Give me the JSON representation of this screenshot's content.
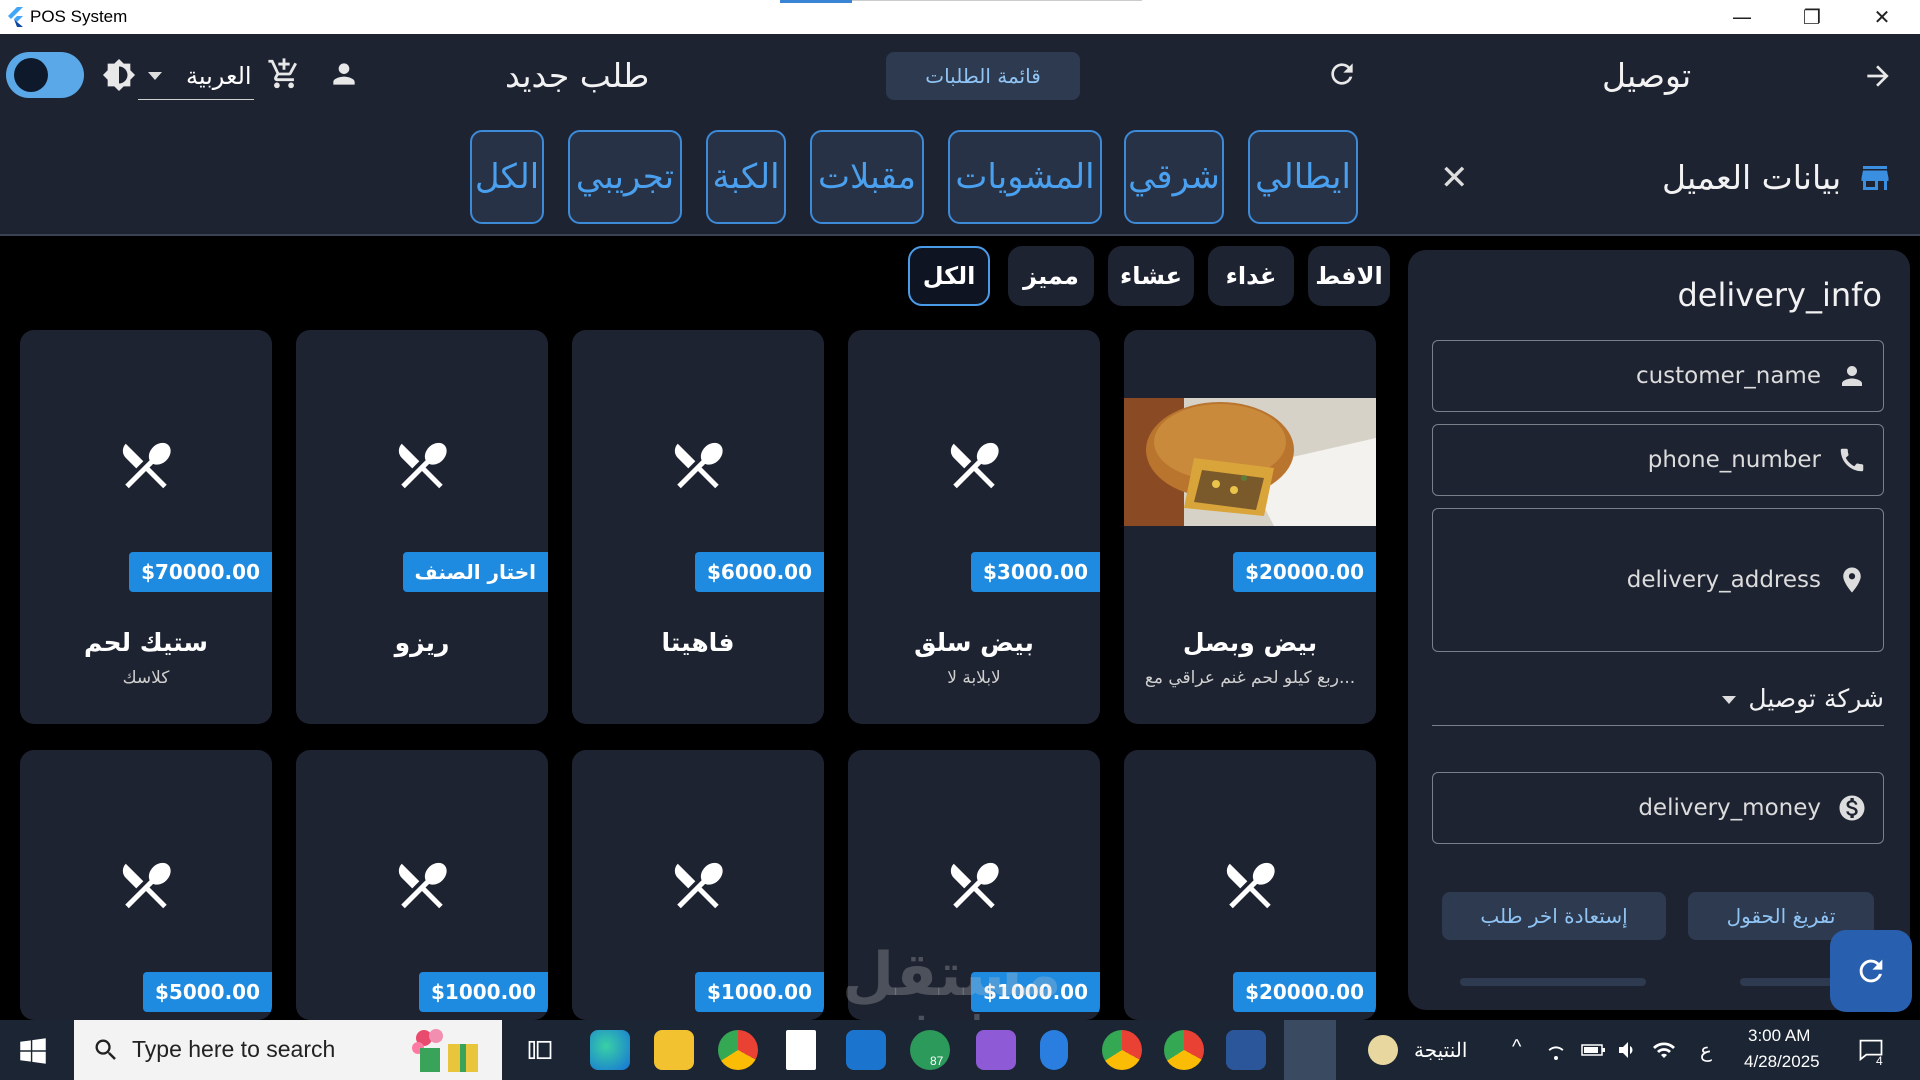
{
  "window": {
    "title": "POS System",
    "minimize": "—",
    "restore": "❐",
    "close": "✕"
  },
  "header": {
    "language": "العربية",
    "page_title": "طلب جديد",
    "orders_button": "قائمة الطلبات",
    "order_type": "توصيل"
  },
  "categories": [
    "ايطالي",
    "شرقي",
    "المشويات",
    "مقبلات",
    "الكبة",
    "تجريبي",
    "الكل"
  ],
  "customer_section_title": "بيانات العميل",
  "filters": [
    "الافط",
    "غداء",
    "عشاء",
    "مميز",
    "الكل"
  ],
  "products_row1": [
    {
      "name": "بيض وبصل",
      "desc": "ربع كيلو لحم غنم عراقي مع...",
      "price": "$20000.00",
      "has_photo": true
    },
    {
      "name": "بيض سلق",
      "desc": "لابلابة لا",
      "price": "$3000.00",
      "has_photo": false
    },
    {
      "name": "فاهيتا",
      "desc": "",
      "price": "$6000.00",
      "has_photo": false
    },
    {
      "name": "ريزو",
      "desc": "",
      "price": "اختار الصنف",
      "has_photo": false
    },
    {
      "name": "ستيك لحم",
      "desc": "كلاسك",
      "price": "$70000.00",
      "has_photo": false
    }
  ],
  "products_row2": [
    {
      "price": "$20000.00"
    },
    {
      "price": "$1000.00"
    },
    {
      "price": "$1000.00"
    },
    {
      "price": "$1000.00"
    },
    {
      "price": "$5000.00"
    }
  ],
  "delivery_panel": {
    "title": "delivery_info",
    "customer_name_placeholder": "customer_name",
    "phone_placeholder": "phone_number",
    "address_placeholder": "delivery_address",
    "company_select": "شركة توصيل",
    "money_placeholder": "delivery_money",
    "clear_button": "تفريغ الحقول",
    "restore_button": "إستعادة اخر طلب"
  },
  "watermark": {
    "main": "مستقل",
    "sub": "mostaql.com"
  },
  "taskbar": {
    "search_placeholder": "Type here to search",
    "chrome_badge": "87",
    "weather_text": "النتيجة",
    "lang_indicator": "ع",
    "time": "3:00 AM",
    "date": "4/28/2025",
    "notification_count": "4"
  },
  "colors": {
    "accent": "#1e8be0",
    "surface": "#1e2332",
    "background": "#000000",
    "category_text": "#4aa0ee"
  }
}
